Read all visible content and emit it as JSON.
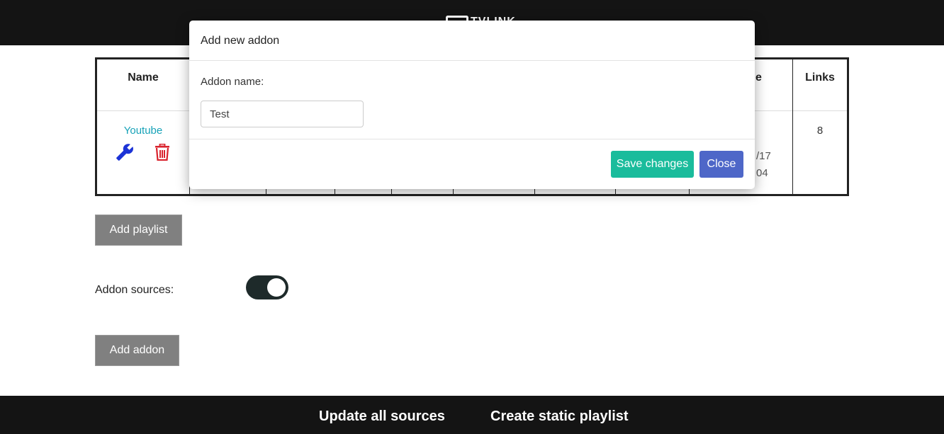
{
  "colors": {
    "topbar": "#141414",
    "link": "#17a2b8",
    "wrench": "#1c33d6",
    "trash": "#d9232d",
    "save": "#1abc9c",
    "close": "#4e67c8",
    "gray_button": "#808080",
    "toggle_on": "#1e2a2a"
  },
  "header": {
    "logo_text": "TVLINK"
  },
  "table": {
    "headers": {
      "name": "Name",
      "partial_header": "e",
      "links": "Links"
    },
    "rows": [
      {
        "name": "Youtube",
        "edit_icon": "wrench-icon",
        "delete_icon": "trash-icon",
        "partial_date": "/17",
        "partial_time": "04",
        "links": "8"
      }
    ]
  },
  "actions": {
    "add_playlist": "Add playlist",
    "addon_sources_label": "Addon sources:",
    "addon_sources_enabled": true,
    "add_addon": "Add addon"
  },
  "footer": {
    "update_all": "Update all sources",
    "create_static": "Create static playlist"
  },
  "modal": {
    "title": "Add new addon",
    "field_label": "Addon name:",
    "field_value": "Test",
    "save_label": "Save changes",
    "close_label": "Close"
  }
}
